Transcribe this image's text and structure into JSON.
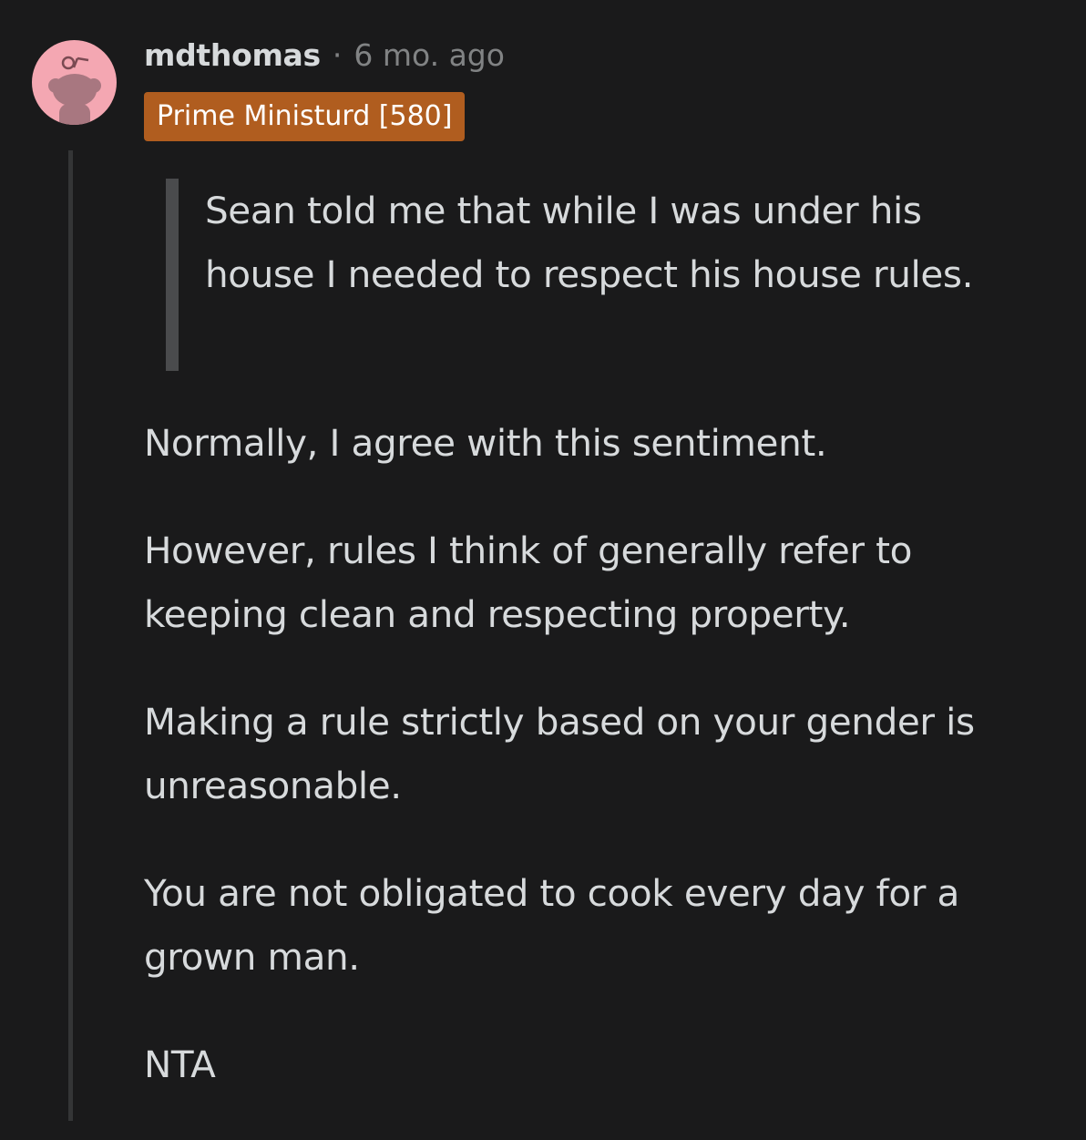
{
  "comment": {
    "author": "mdthomas",
    "separator": "·",
    "timestamp": "6 mo. ago",
    "flair": "Prime Ministurd [580]",
    "avatar_icon": "snoo-avatar-icon",
    "quote": "Sean told me that while I was under his house I needed to respect his house rules.",
    "paragraphs": [
      "Normally, I agree with this sentiment.",
      "However, rules I think of generally refer to keeping clean and respecting property.",
      "Making a rule strictly based on your gender is unreasonable.",
      "You are not obligated to cook every day for a grown man.",
      "NTA"
    ]
  },
  "colors": {
    "background": "#1a1a1b",
    "text": "#d7dadc",
    "muted": "#818384",
    "flair_bg": "#b05d1f",
    "avatar_bg": "#f4a7b2",
    "thread_line": "#343536",
    "quote_bar": "#4a4b4d"
  }
}
